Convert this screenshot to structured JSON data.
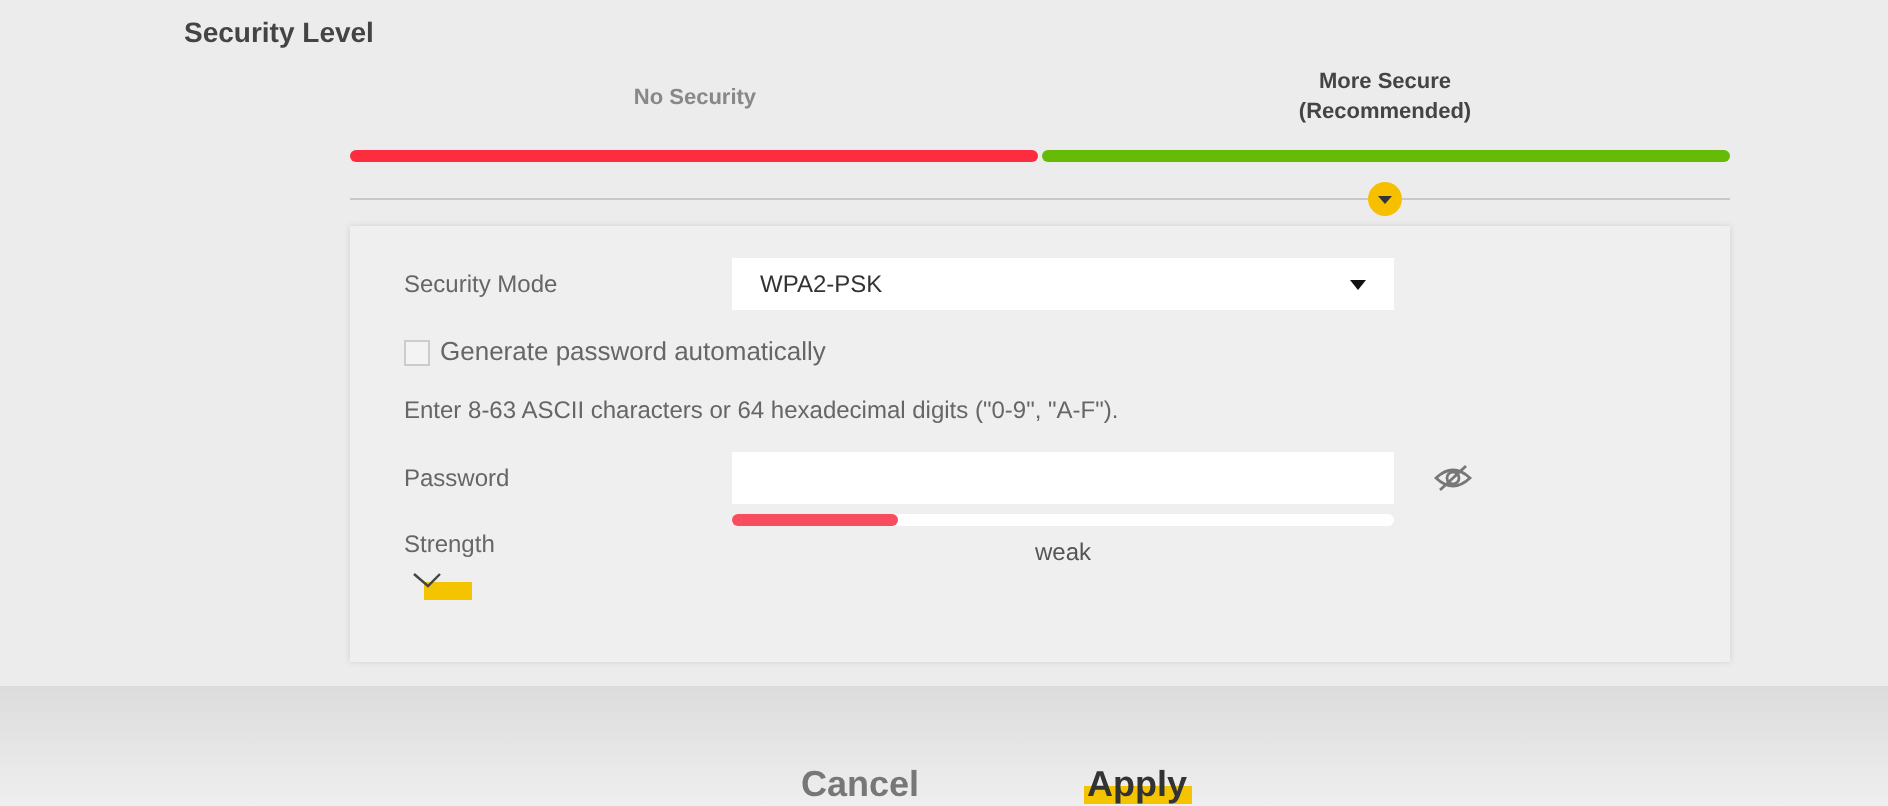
{
  "section_title": "Security Level",
  "security_levels": [
    {
      "label": "No Security",
      "color": "#fb2d3f",
      "selected": false
    },
    {
      "label": "More Secure\n(Recommended)",
      "color": "#65bb08",
      "selected": true
    }
  ],
  "form": {
    "security_mode": {
      "label": "Security Mode",
      "value": "WPA2-PSK"
    },
    "generate_password": {
      "label": "Generate password automatically",
      "checked": false
    },
    "hint": "Enter 8-63 ASCII characters or 64 hexadecimal digits (\"0-9\", \"A-F\").",
    "password": {
      "label": "Password"
    },
    "strength": {
      "label": "Strength",
      "level": 0.25,
      "reading": "weak"
    }
  },
  "buttons": [
    {
      "label": "Cancel",
      "kind": "secondary"
    },
    {
      "label": "Apply",
      "kind": "primary"
    }
  ]
}
